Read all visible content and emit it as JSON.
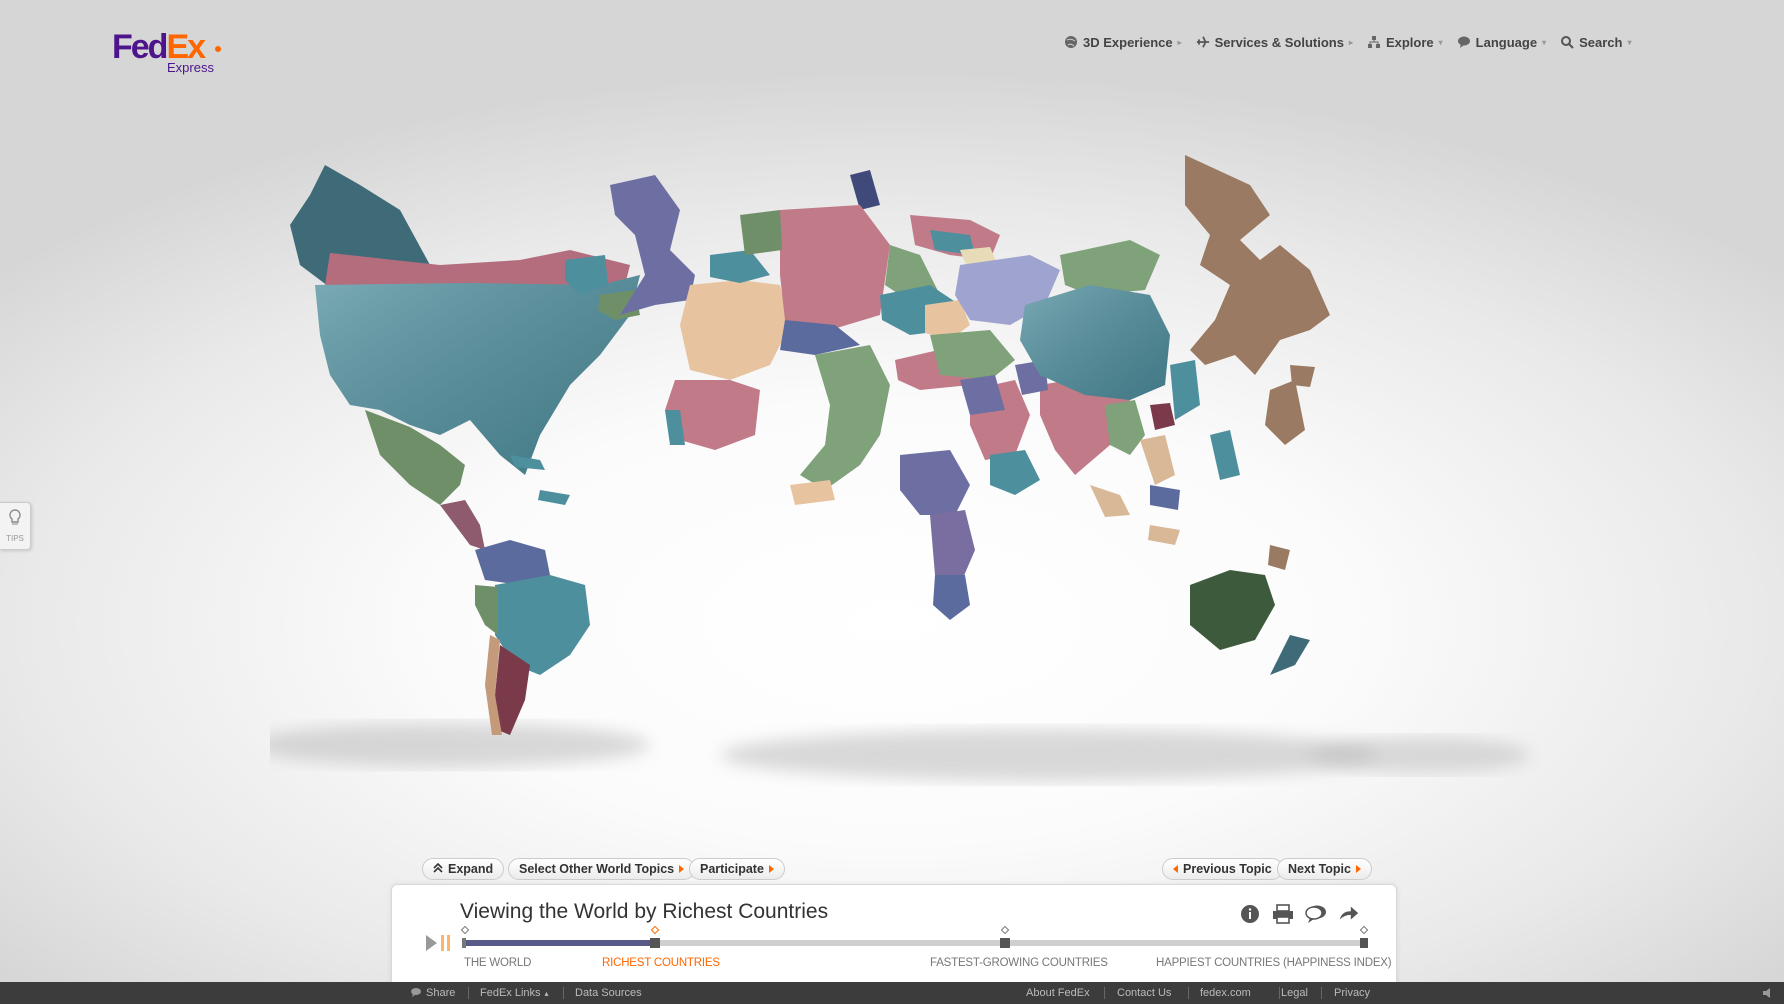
{
  "header": {
    "logo": {
      "brand_part1": "Fed",
      "brand_part2": "Ex",
      "sub": "Express"
    },
    "nav": [
      {
        "label": "3D Experience",
        "icon": "globe-icon"
      },
      {
        "label": "Services & Solutions",
        "icon": "plane-icon"
      },
      {
        "label": "Explore",
        "icon": "sitemap-icon"
      },
      {
        "label": "Language",
        "icon": "speech-bubble-icon"
      },
      {
        "label": "Search",
        "icon": "search-icon"
      }
    ]
  },
  "tips": {
    "label": "TIPS"
  },
  "controls": {
    "expand": "Expand",
    "select_topics": "Select Other World Topics",
    "participate": "Participate",
    "previous_topic": "Previous Topic",
    "next_topic": "Next Topic"
  },
  "panel": {
    "title": "Viewing the World by Richest Countries",
    "icons": [
      "info-icon",
      "print-icon",
      "comment-icon",
      "share-icon"
    ],
    "timeline": {
      "progress": 0.21,
      "labels": [
        "THE WORLD",
        "RICHEST COUNTRIES",
        "FASTEST-GROWING COUNTRIES",
        "HAPPIEST COUNTRIES (HAPPINESS INDEX)"
      ],
      "active_index": 1
    }
  },
  "footer": {
    "left": [
      "Share",
      "FedEx Links",
      "Data Sources"
    ],
    "right": [
      "About FedEx",
      "Contact Us",
      "fedex.com",
      "Legal",
      "Privacy"
    ]
  },
  "colors": {
    "brand_purple": "#4d148c",
    "brand_orange": "#ff6600",
    "teal": "#4f8a96",
    "rose": "#c07a88",
    "slate": "#6d6fa3",
    "sage": "#7fa27a",
    "peach": "#e8c3a0",
    "brown": "#9a7a62"
  }
}
